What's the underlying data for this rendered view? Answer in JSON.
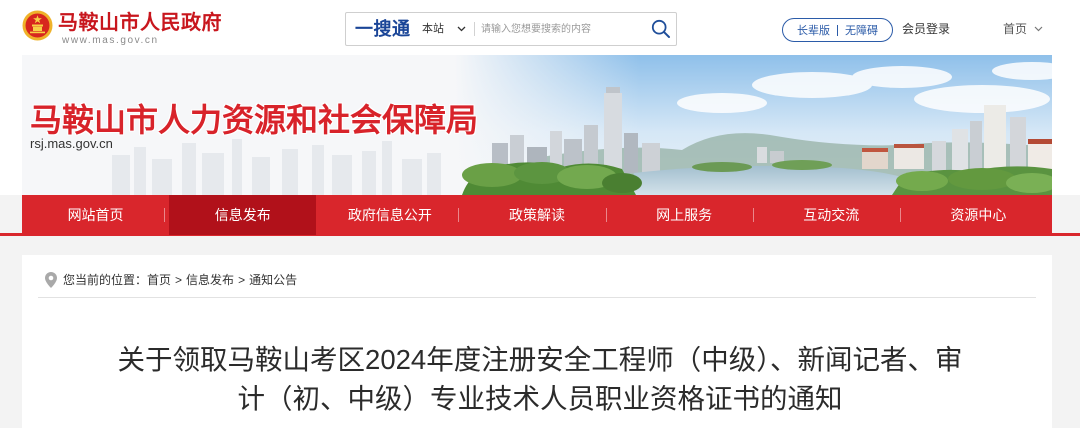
{
  "header": {
    "site_name": "马鞍山市人民政府",
    "site_url": "www.mas.gov.cn",
    "search": {
      "brand": "一搜通",
      "scope": "本站",
      "placeholder": "请输入您想要搜索的内容",
      "value": ""
    },
    "elder_mode": "长辈版",
    "accessibility": "无障碍",
    "login": "会员登录",
    "home": "首页"
  },
  "banner": {
    "title": "马鞍山市人力资源和社会保障局",
    "url": "rsj.mas.gov.cn"
  },
  "nav": {
    "items": [
      {
        "label": "网站首页",
        "active": false
      },
      {
        "label": "信息发布",
        "active": true
      },
      {
        "label": "政府信息公开",
        "active": false
      },
      {
        "label": "政策解读",
        "active": false
      },
      {
        "label": "网上服务",
        "active": false
      },
      {
        "label": "互动交流",
        "active": false
      },
      {
        "label": "资源中心",
        "active": false
      }
    ]
  },
  "breadcrumb": {
    "prefix": "您当前的位置：",
    "separator": ">",
    "items": [
      "首页",
      "信息发布",
      "通知公告"
    ]
  },
  "article": {
    "title": "关于领取马鞍山考区2024年度注册安全工程师（中级）、新闻记者、审计（初、中级）专业技术人员职业资格证书的通知"
  },
  "icons": {
    "emblem": "national-emblem-icon",
    "search": "search-icon",
    "scope_dropdown": "chevron-down-icon",
    "home_dropdown": "chevron-down-icon",
    "location": "location-pin-icon"
  },
  "colors": {
    "gov_red": "#c8161d",
    "nav_red": "#d9262c",
    "nav_active": "#b1111a",
    "accent_blue": "#2b5ba8",
    "search_brand_blue": "#1a4597"
  }
}
